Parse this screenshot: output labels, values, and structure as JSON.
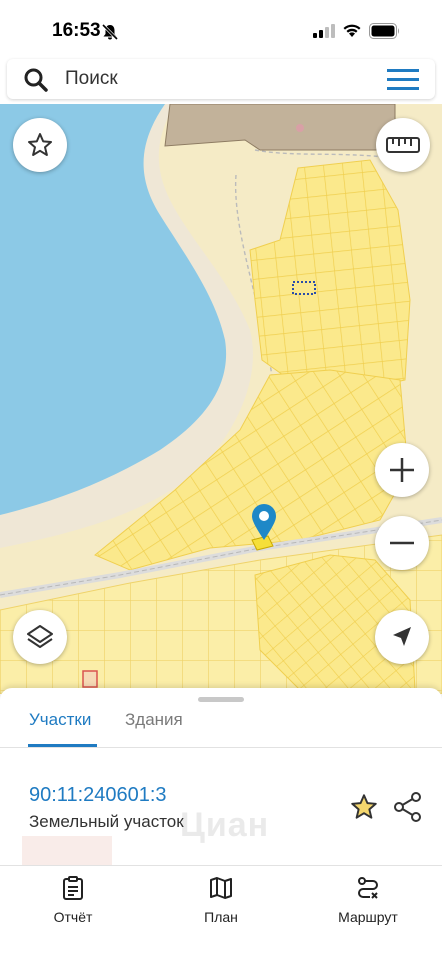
{
  "status_bar": {
    "time": "16:53"
  },
  "search": {
    "placeholder": "Поиск"
  },
  "map": {
    "colors": {
      "water": "#8cc9e6",
      "land": "#f5ebc6",
      "beach": "#f0e9d8",
      "parcels": "#fbe98c",
      "parcel_lines": "#f2d45a",
      "pin": "#1e88c7"
    }
  },
  "sheet": {
    "tabs": [
      {
        "label": "Участки",
        "active": true
      },
      {
        "label": "Здания",
        "active": false
      }
    ],
    "result": {
      "cadastral_number": "90:11:240601:3",
      "type": "Земельный участок"
    },
    "watermark": "Циан"
  },
  "bottom_nav": [
    {
      "label": "Отчёт",
      "icon": "report-icon"
    },
    {
      "label": "План",
      "icon": "map-plan-icon"
    },
    {
      "label": "Маршрут",
      "icon": "route-icon"
    }
  ]
}
